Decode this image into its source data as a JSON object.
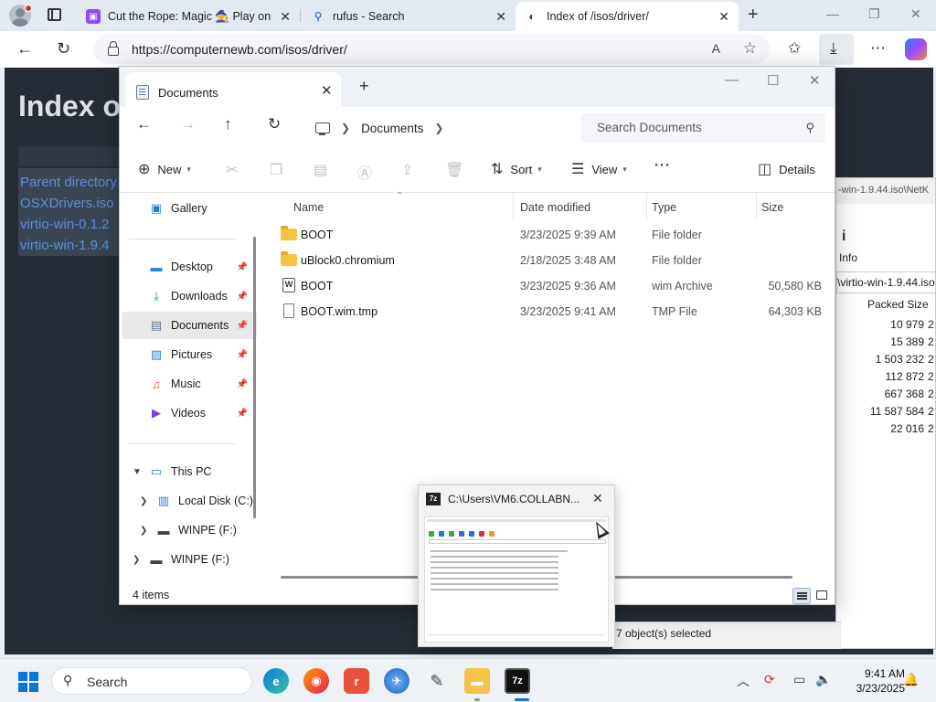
{
  "browser": {
    "tabs": [
      {
        "title": "Cut the Rope: Magic 🧙 Play on",
        "icon": "twitch-icon"
      },
      {
        "title": "rufus - Search",
        "icon": "search-icon"
      },
      {
        "title": "Index of /isos/driver/",
        "icon": "site-icon",
        "active": true
      }
    ],
    "url": "https://computernewb.com/isos/driver/"
  },
  "webpage": {
    "title": "Index o",
    "links": [
      "Parent directory",
      "OSXDrivers.iso",
      "virtio-win-0.1.2",
      "virtio-win-1.9.4"
    ]
  },
  "sevenzip": {
    "title": "-win-1.9.44.iso\\NetK",
    "info_label": "Info",
    "path": "\\virtio-win-1.9.44.iso",
    "packed_size_header": "Packed Size",
    "packed_sizes": [
      "10 979",
      "15 389",
      "1 503 232",
      "112 872",
      "667 368",
      "11 587 584",
      "22 016"
    ],
    "col2": [
      "2",
      "2",
      "2",
      "2",
      "2",
      "2",
      "2"
    ],
    "status": "7 object(s) selected"
  },
  "explorer": {
    "tab_title": "Documents",
    "breadcrumb": "Documents",
    "search_placeholder": "Search Documents",
    "toolbar": {
      "new": "New",
      "sort": "Sort",
      "view": "View",
      "details": "Details"
    },
    "nav": {
      "gallery": "Gallery",
      "desktop": "Desktop",
      "downloads": "Downloads",
      "documents": "Documents",
      "pictures": "Pictures",
      "music": "Music",
      "videos": "Videos",
      "this_pc": "This PC",
      "local_disk": "Local Disk (C:)",
      "winpe1": "WINPE (F:)",
      "winpe2": "WINPE (F:)"
    },
    "columns": {
      "name": "Name",
      "date": "Date modified",
      "type": "Type",
      "size": "Size"
    },
    "files": [
      {
        "name": "BOOT",
        "date": "3/23/2025 9:39 AM",
        "type": "File folder",
        "size": "",
        "icon": "folder-icon"
      },
      {
        "name": "uBlock0.chromium",
        "date": "2/18/2025 3:48 AM",
        "type": "File folder",
        "size": "",
        "icon": "folder-icon"
      },
      {
        "name": "BOOT",
        "date": "3/23/2025 9:36 AM",
        "type": "wim Archive",
        "size": "50,580 KB",
        "icon": "wim-file-icon"
      },
      {
        "name": "BOOT.wim.tmp",
        "date": "3/23/2025 9:41 AM",
        "type": "TMP File",
        "size": "64,303 KB",
        "icon": "file-icon"
      }
    ],
    "status": "4 items"
  },
  "thumbnail": {
    "title": "C:\\Users\\VM6.COLLABN...",
    "app_icon_text": "7z"
  },
  "taskbar": {
    "search": "Search",
    "time": "9:41 AM",
    "date": "3/23/2025",
    "sevenzip_label": "7z"
  }
}
